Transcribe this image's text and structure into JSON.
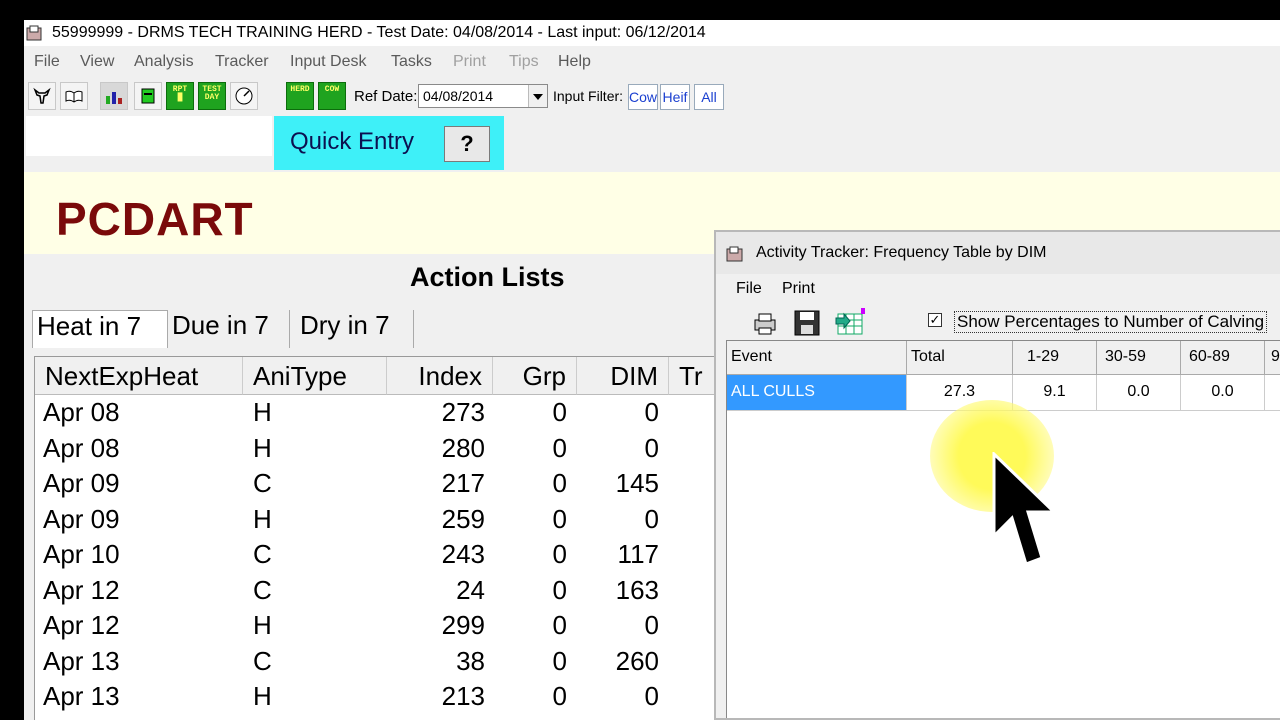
{
  "window": {
    "title": "55999999  -  DRMS TECH TRAINING HERD  -  Test Date: 04/08/2014  -  Last input: 06/12/2014"
  },
  "menu": [
    {
      "label": "File",
      "enabled": true
    },
    {
      "label": "View",
      "enabled": true
    },
    {
      "label": "Analysis",
      "enabled": true
    },
    {
      "label": "Tracker",
      "enabled": true
    },
    {
      "label": "Input Desk",
      "enabled": true
    },
    {
      "label": "Tasks",
      "enabled": true
    },
    {
      "label": "Print",
      "enabled": false
    },
    {
      "label": "Tips",
      "enabled": false
    },
    {
      "label": "Help",
      "enabled": true
    }
  ],
  "toolbar": {
    "icons": [
      "cow-icon",
      "book-icon",
      "cow-chart-icon",
      "cow-head-icon",
      "rpt-icon",
      "test-day-icon",
      "gauge-icon"
    ],
    "green_buttons": [
      {
        "name": "herd-summary-button",
        "text": "HERD"
      },
      {
        "name": "cow-summary-button",
        "text": "COW"
      }
    ],
    "ref_date_label": "Ref Date:",
    "ref_date_value": "04/08/2014",
    "input_filter_label": "Input Filter:",
    "filters": [
      "Cow",
      "Heif",
      "All"
    ]
  },
  "quick_entry": {
    "label": "Quick Entry",
    "help": "?",
    "value": ""
  },
  "brand": "PCDART",
  "action_lists": {
    "title": "Action Lists",
    "tabs": [
      "Heat in 7",
      "Due in 7",
      "Dry in 7"
    ],
    "columns": [
      "NextExpHeat",
      "AniType",
      "Index",
      "Grp",
      "DIM",
      "Tr"
    ],
    "rows": [
      [
        "Apr 08",
        "H",
        "273",
        "0",
        "0"
      ],
      [
        "Apr 08",
        "H",
        "280",
        "0",
        "0"
      ],
      [
        "Apr 09",
        "C",
        "217",
        "0",
        "145"
      ],
      [
        "Apr 09",
        "H",
        "259",
        "0",
        "0"
      ],
      [
        "Apr 10",
        "C",
        "243",
        "0",
        "117"
      ],
      [
        "Apr 12",
        "C",
        "24",
        "0",
        "163"
      ],
      [
        "Apr 12",
        "H",
        "299",
        "0",
        "0"
      ],
      [
        "Apr 13",
        "C",
        "38",
        "0",
        "260"
      ],
      [
        "Apr 13",
        "H",
        "213",
        "0",
        "0"
      ]
    ]
  },
  "tracker": {
    "title": "Activity Tracker: Frequency Table by DIM",
    "menu": [
      "File",
      "Print"
    ],
    "checkbox_checked": true,
    "checkbox_label": "Show Percentages to Number of Calving",
    "columns": [
      "Event",
      "Total",
      "1-29",
      "30-59",
      "60-89",
      "9"
    ],
    "rows": [
      [
        "ALL CULLS",
        "27.3",
        "9.1",
        "0.0",
        "0.0",
        ""
      ]
    ]
  }
}
